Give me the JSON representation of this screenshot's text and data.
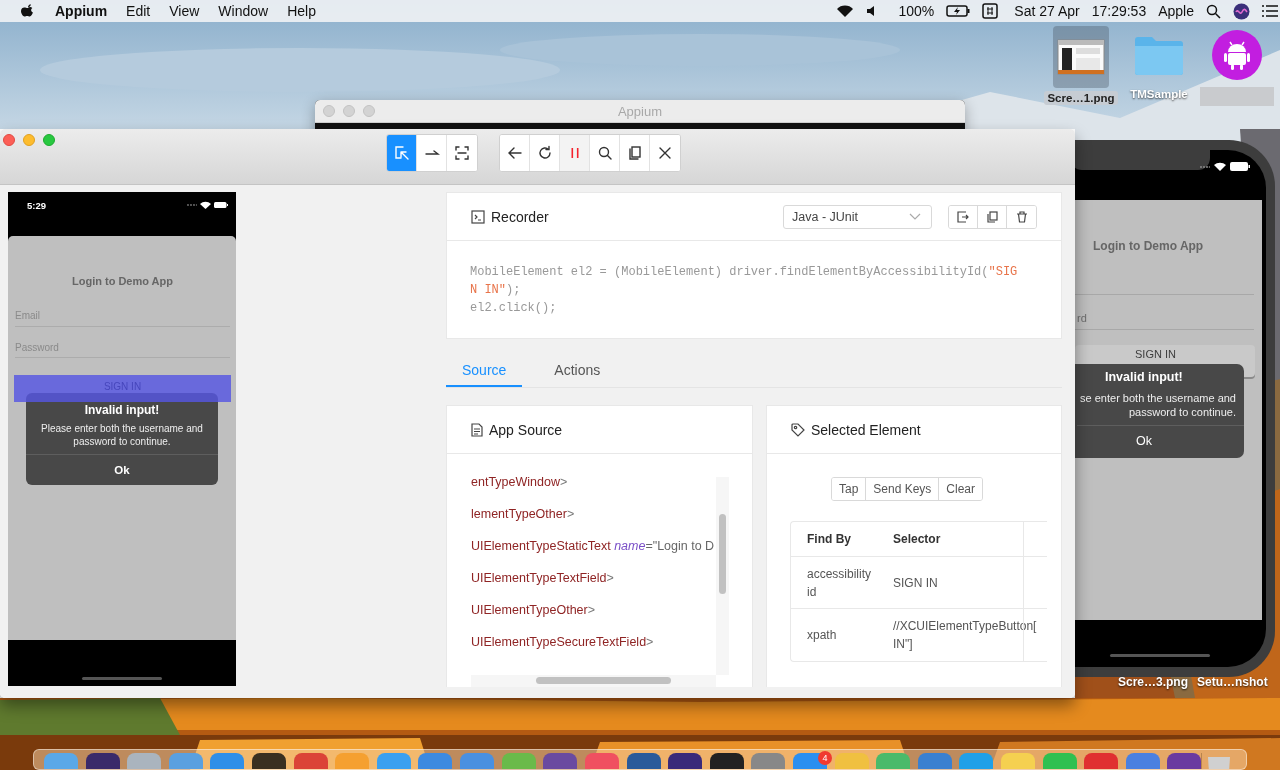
{
  "menu_bar": {
    "app_name": "Appium",
    "menus": [
      "Edit",
      "View",
      "Window",
      "Help"
    ],
    "battery": "100%",
    "date": "Sat 27 Apr",
    "time": "17:29:53",
    "user": "Apple"
  },
  "desktop_icons": [
    {
      "kind": "screenshot",
      "label": "Scre…1.png",
      "selected": true
    },
    {
      "kind": "folder",
      "label": "TMSample",
      "selected": false
    },
    {
      "kind": "android",
      "selected": false
    }
  ],
  "desktop_files": [
    "Scre…3.png",
    "Setu…nshot"
  ],
  "background_window": {
    "title": "Appium"
  },
  "simulator": {
    "title": "Login to Demo App",
    "password_placeholder": "rd",
    "button": "SIGN IN",
    "alert": {
      "title": "Invalid input!",
      "message": [
        "se enter both the username and",
        "password to continue."
      ],
      "button": "Ok"
    }
  },
  "inspector": {
    "toolbar": [
      {
        "buttons": [
          {
            "kind": "select",
            "selected": true
          },
          {
            "kind": "swipe",
            "selected": false
          },
          {
            "kind": "tap",
            "selected": false
          }
        ]
      },
      {
        "buttons": [
          {
            "kind": "back",
            "selected": false
          },
          {
            "kind": "refresh",
            "selected": false
          },
          {
            "kind": "pause",
            "selected": false
          },
          {
            "kind": "search",
            "selected": false
          },
          {
            "kind": "copy",
            "selected": false
          },
          {
            "kind": "close",
            "selected": false
          }
        ]
      }
    ],
    "screenshot": {
      "time": "5:29",
      "title": "Login to Demo App",
      "email_placeholder": "Email",
      "password_placeholder": "Password",
      "button": "SIGN IN",
      "alert": {
        "title": "Invalid input!",
        "message": "Please enter both the username and password to continue.",
        "button": "Ok"
      }
    },
    "recorder": {
      "title": "Recorder",
      "language": "Java - JUnit",
      "code": [
        [
          {
            "kind": "plain",
            "text": "MobileElement el2 = (MobileElement) driver.findElementByAccessibilityId("
          },
          {
            "kind": "string",
            "text": "\"SIGN IN\""
          },
          {
            "kind": "plain",
            "text": ");"
          }
        ],
        [
          {
            "kind": "plain",
            "text": "el2.click();"
          }
        ]
      ]
    },
    "tabs": [
      {
        "label": "Source",
        "selected": true
      },
      {
        "label": "Actions",
        "selected": false
      }
    ],
    "app_source": {
      "title": "App Source",
      "lines": [
        {
          "tag": "entTypeWindow",
          "close": ">"
        },
        {
          "tag": "lementTypeOther",
          "close": ">"
        },
        {
          "tag": "UIElementTypeStaticText",
          "attribute": "name",
          "value": "=\"Login to D"
        },
        {
          "tag": "UIElementTypeTextField",
          "close": ">"
        },
        {
          "tag": "UIElementTypeOther",
          "close": ">"
        },
        {
          "tag": "UIElementTypeSecureTextField",
          "close": ">"
        }
      ]
    },
    "selected_element": {
      "title": "Selected Element",
      "actions": [
        "Tap",
        "Send Keys",
        "Clear"
      ],
      "columns": [
        "Find By",
        "Selector"
      ],
      "rows": [
        {
          "find_by": "accessibility id",
          "selector": [
            "SIGN IN"
          ]
        },
        {
          "find_by": "xpath",
          "selector": [
            "//XCUIElementTypeButton[",
            "IN\"]"
          ]
        }
      ]
    }
  },
  "dock": {
    "items": [
      {
        "kind": "app",
        "color": "#5aa8e8"
      },
      {
        "kind": "app",
        "color": "#3a2a6a"
      },
      {
        "kind": "app",
        "color": "#aab4be"
      },
      {
        "kind": "app",
        "color": "#5aa0e0"
      },
      {
        "kind": "app",
        "color": "#2f8fe8"
      },
      {
        "kind": "app",
        "color": "#3a3020"
      },
      {
        "kind": "app",
        "color": "#db4437"
      },
      {
        "kind": "app",
        "color": "#f5a030"
      },
      {
        "kind": "app",
        "color": "#3aa0f0"
      },
      {
        "kind": "app",
        "color": "#3d8ae0"
      },
      {
        "kind": "app",
        "color": "#4a90e0"
      },
      {
        "kind": "app",
        "color": "#6aba4a"
      },
      {
        "kind": "app",
        "color": "#6a4aa0"
      },
      {
        "kind": "app",
        "color": "#f05060"
      },
      {
        "kind": "app",
        "color": "#2a5a9a"
      },
      {
        "kind": "app",
        "color": "#3a2a7a"
      },
      {
        "kind": "app",
        "color": "#222222"
      },
      {
        "kind": "app",
        "color": "#888888"
      },
      {
        "kind": "app",
        "color": "#2a8ff0",
        "badge": "4"
      },
      {
        "kind": "app",
        "color": "#f0c040"
      },
      {
        "kind": "app",
        "color": "#4aba6a"
      },
      {
        "kind": "app",
        "color": "#3a80d0"
      },
      {
        "kind": "app",
        "color": "#20a0e8"
      },
      {
        "kind": "app",
        "color": "#f5d050"
      },
      {
        "kind": "app",
        "color": "#30c050"
      },
      {
        "kind": "app",
        "color": "#e03030"
      },
      {
        "kind": "app",
        "color": "#4a80e0"
      },
      {
        "kind": "app",
        "color": "#6a3aa0"
      },
      {
        "kind": "trash",
        "color": "#d0d0d0"
      }
    ]
  }
}
